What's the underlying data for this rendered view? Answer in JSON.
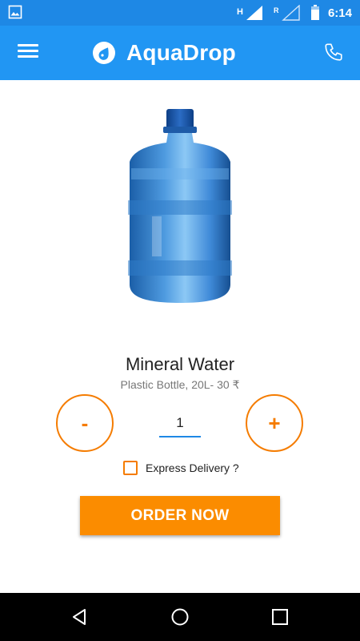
{
  "status_bar": {
    "time": "6:14",
    "icons": [
      "image-icon",
      "signal-h-icon",
      "signal-r-icon",
      "battery-icon"
    ]
  },
  "app_bar": {
    "title": "AquaDrop",
    "menu_icon": "hamburger-menu-icon",
    "logo_icon": "water-drop-logo-icon",
    "call_icon": "phone-icon"
  },
  "product": {
    "image": "water-bottle-20l",
    "name": "Mineral Water",
    "description": "Plastic Bottle, 20L- 30 ₹"
  },
  "quantity": {
    "decrement_label": "-",
    "increment_label": "+",
    "value": "1"
  },
  "express_delivery": {
    "label": "Express Delivery ?",
    "checked": false
  },
  "order_button": {
    "label": "ORDER NOW"
  },
  "nav_bar": {
    "icons": [
      "back-icon",
      "home-icon",
      "recents-icon"
    ]
  },
  "colors": {
    "status_bar": "#1e88e5",
    "app_bar": "#2196f3",
    "accent": "#f57c00",
    "order_button": "#fb8c00"
  }
}
